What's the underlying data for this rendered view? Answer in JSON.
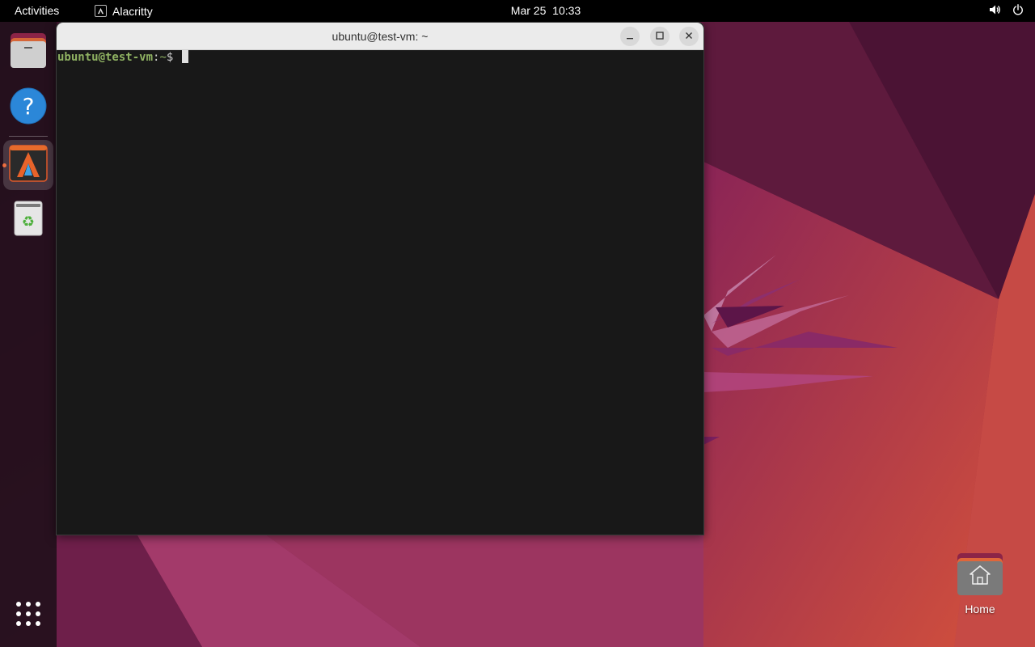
{
  "topbar": {
    "activities_label": "Activities",
    "app_name": "Alacritty",
    "clock_date": "Mar 25",
    "clock_time": "10:33",
    "tray_icons": [
      "volume-icon",
      "power-icon"
    ]
  },
  "dock": {
    "items": [
      {
        "name": "files",
        "icon": "folder-icon"
      },
      {
        "name": "help",
        "icon": "help-icon",
        "glyph": "?"
      },
      {
        "name": "alacritty",
        "icon": "alacritty-icon",
        "active": true
      },
      {
        "name": "trash",
        "icon": "trash-icon"
      }
    ],
    "show_apps_icon": "grid-icon"
  },
  "terminal": {
    "title": "ubuntu@test-vm: ~",
    "prompt_user": "ubuntu@test-vm",
    "prompt_sep": ":",
    "prompt_path": "~",
    "prompt_symbol": "$ "
  },
  "desktop": {
    "home_label": "Home"
  },
  "colors": {
    "accent": "#e95420",
    "prompt_green": "#8fb262",
    "terminal_bg": "#181818",
    "titlebar_bg": "#ebebeb"
  }
}
